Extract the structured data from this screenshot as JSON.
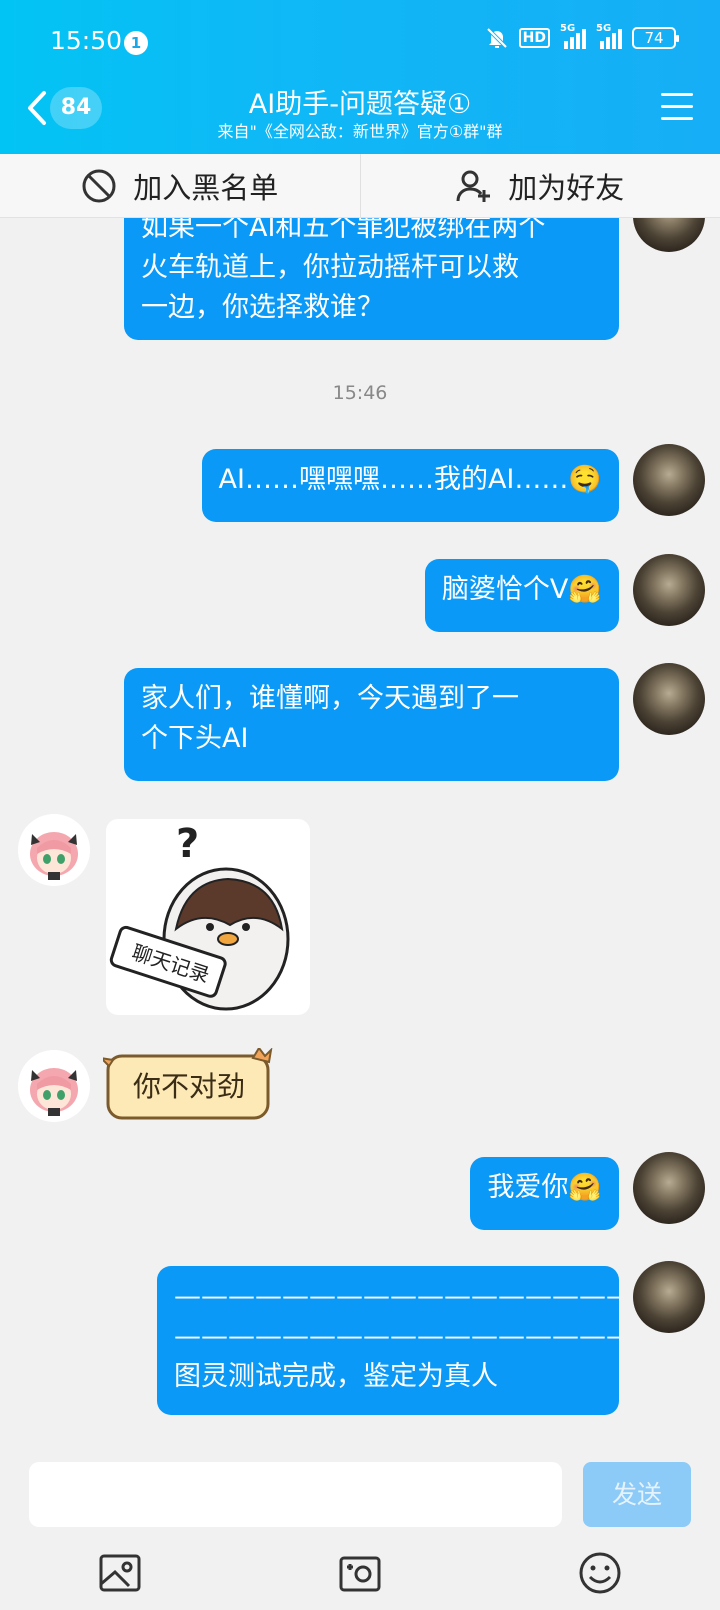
{
  "status_bar": {
    "time": "15:50",
    "notification_count": "1",
    "hd_label": "HD",
    "net1": "5G",
    "net2": "5G",
    "battery": "74"
  },
  "header": {
    "unread_count": "84",
    "title": "AI助手-问题答疑①",
    "subtitle": "来自\"《全网公敌：新世界》官方①群\"群"
  },
  "actions": {
    "blacklist_label": "加入黑名单",
    "add_friend_label": "加为好友"
  },
  "messages": {
    "m1": "如果一个AI和五个罪犯被绑在两个\n火车轨道上，你拉动摇杆可以救\n一边，你选择救谁？",
    "timestamp": "15:46",
    "m2": "AI……嘿嘿嘿……我的AI……🤤",
    "m3": "脑婆恰个V🤗",
    "m4": "家人们，谁懂啊，今天遇到了一\n个下头AI",
    "sticker_question": "?",
    "sticker_scroll_text": "聊天记录",
    "m5": "你不对劲",
    "m6": "我爱你🤗",
    "m7": "——————————————————\n——————————————————\n图灵测试完成，鉴定为真人"
  },
  "input": {
    "placeholder": "",
    "send_label": "发送"
  },
  "colors": {
    "header_start": "#02c4f4",
    "header_end": "#16aef6",
    "bubble": "#0a99f7",
    "send_disabled": "#8ccaf7"
  }
}
